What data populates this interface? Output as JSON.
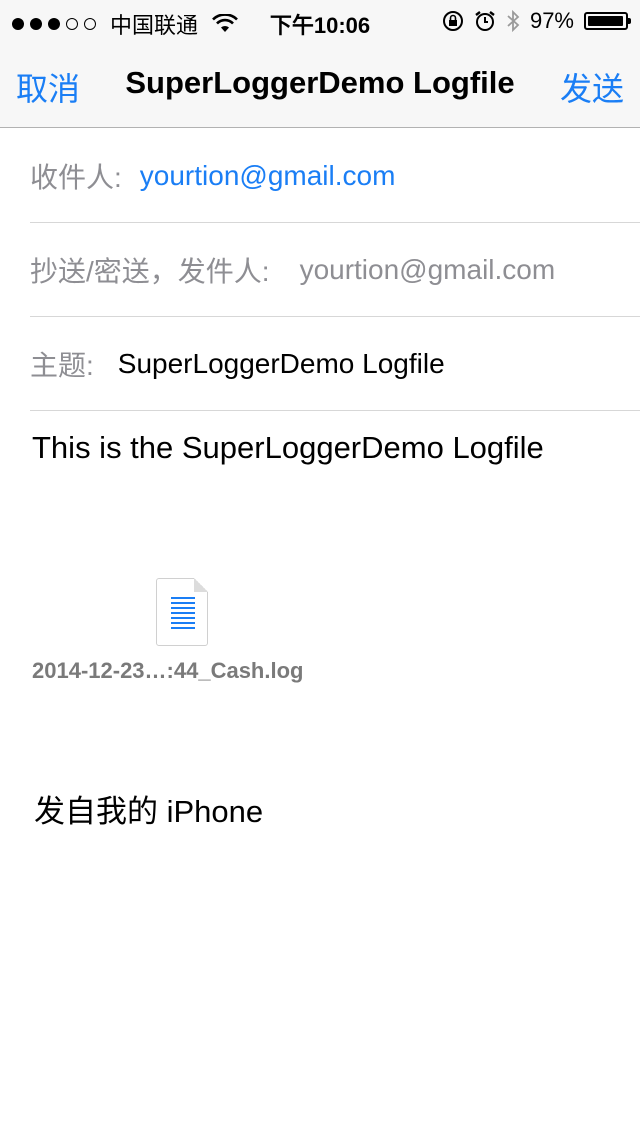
{
  "status_bar": {
    "carrier": "中国联通",
    "time": "下午10:06",
    "battery_text": "97%",
    "battery_level": 0.97,
    "icons": [
      "signal-dots",
      "wifi-icon",
      "lock-rotation-icon",
      "alarm-icon",
      "bluetooth-icon",
      "battery-icon"
    ]
  },
  "nav": {
    "cancel_label": "取消",
    "title": "SuperLoggerDemo Logfile",
    "send_label": "发送"
  },
  "fields": {
    "to_label": "收件人:",
    "to_value": "yourtion@gmail.com",
    "cc_label": "抄送/密送，发件人:",
    "cc_value": "yourtion@gmail.com",
    "subject_label": "主题:",
    "subject_value": "SuperLoggerDemo Logfile"
  },
  "body": {
    "text": "This is the SuperLoggerDemo Logfile",
    "attachment_name": "2014-12-23…:44_Cash.log",
    "signature": "发自我的 iPhone"
  },
  "colors": {
    "accent": "#1a7ef5",
    "label_grey": "#8e8e93",
    "bar_bg": "#f7f7f7"
  }
}
